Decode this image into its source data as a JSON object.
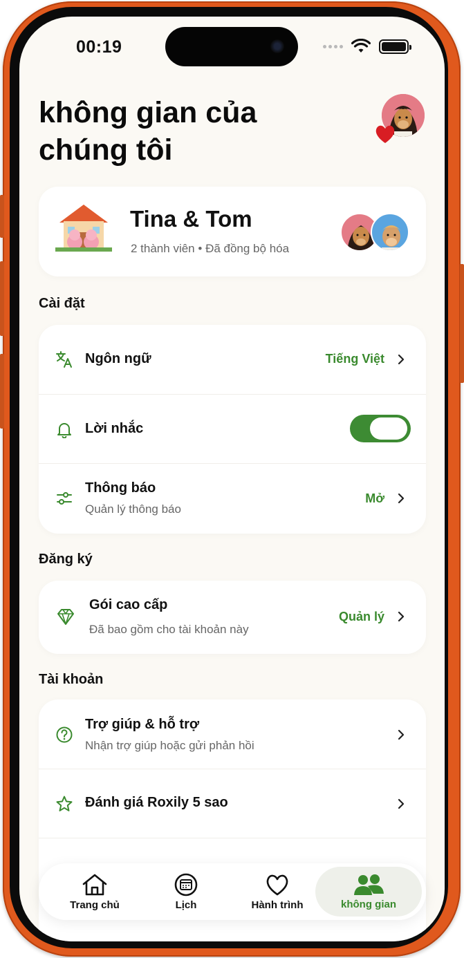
{
  "status_bar": {
    "time": "00:19"
  },
  "header": {
    "title": "không gian của chúng tôi"
  },
  "space": {
    "name": "Tina & Tom",
    "members": "2 thành viên",
    "sync_status": "Đã đồng bộ hóa"
  },
  "settings": {
    "section_label": "Cài đặt",
    "language": {
      "title": "Ngôn ngữ",
      "value": "Tiếng Việt",
      "icon": "translate-icon"
    },
    "reminders": {
      "title": "Lời nhắc",
      "enabled": true,
      "icon": "bell-icon"
    },
    "notifications": {
      "title": "Thông báo",
      "subtitle": "Quản lý thông báo",
      "value": "Mở",
      "icon": "sliders-icon"
    }
  },
  "subscription": {
    "section_label": "Đăng ký",
    "premium": {
      "title": "Gói cao cấp",
      "subtitle": "Đã bao gồm cho tài khoản này",
      "value": "Quản lý",
      "icon": "diamond-icon"
    }
  },
  "account": {
    "section_label": "Tài khoản",
    "help": {
      "title": "Trợ giúp & hỗ trợ",
      "subtitle": "Nhận trợ giúp hoặc gửi phản hồi",
      "icon": "question-icon"
    },
    "rate": {
      "title": "Đánh giá Roxily 5 sao",
      "icon": "star-icon"
    }
  },
  "tab_bar": {
    "tabs": [
      {
        "label": "Trang chủ",
        "icon": "home-icon"
      },
      {
        "label": "Lịch",
        "icon": "calendar-icon"
      },
      {
        "label": "Hành trình",
        "icon": "heart-icon"
      },
      {
        "label": "không gian",
        "icon": "people-icon",
        "active": true
      }
    ]
  },
  "colors": {
    "accent": "#3a8a2e",
    "toggle": "#3d8b33",
    "background": "#fbf9f4",
    "frame": "#e0591d"
  }
}
